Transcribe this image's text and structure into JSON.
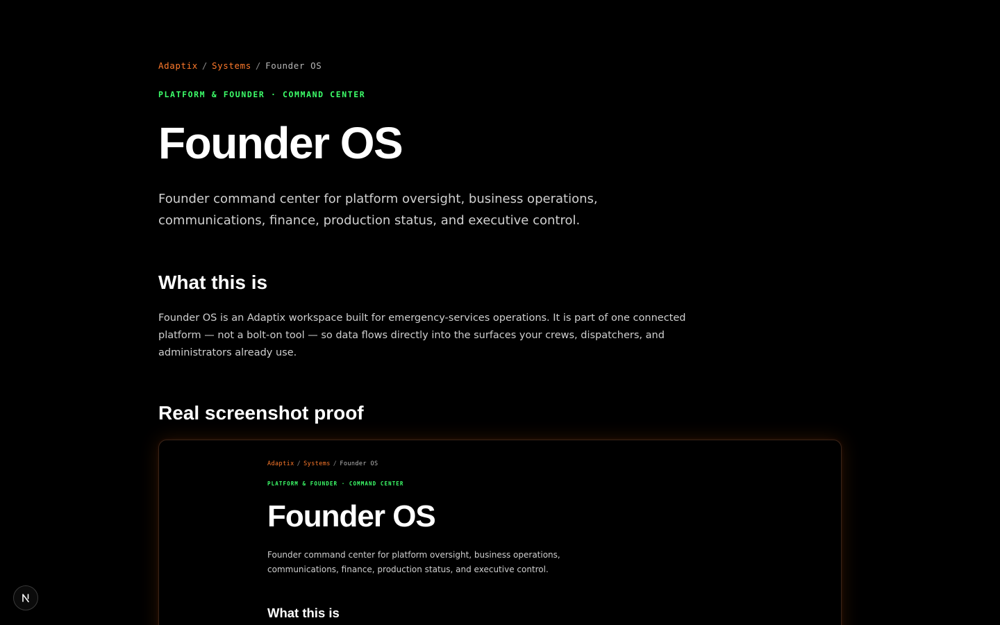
{
  "breadcrumb": {
    "items": [
      "Adaptix",
      "Systems"
    ],
    "separator": "/",
    "current": "Founder OS"
  },
  "eyebrow": "PLATFORM & FOUNDER · COMMAND CENTER",
  "title": "Founder OS",
  "lead": "Founder command center for platform oversight, business operations, communications, finance, production status, and executive control.",
  "sections": {
    "what": {
      "heading": "What this is",
      "body": "Founder OS is an Adaptix workspace built for emergency-services operations. It is part of one connected platform — not a bolt-on tool — so data flows directly into the surfaces your crews, dispatchers, and administrators already use."
    },
    "proof": {
      "heading": "Real screenshot proof"
    }
  },
  "screenshot": {
    "breadcrumb": {
      "items": [
        "Adaptix",
        "Systems"
      ],
      "separator": "/",
      "current": "Founder OS"
    },
    "eyebrow": "PLATFORM & FOUNDER · COMMAND CENTER",
    "title": "Founder OS",
    "lead": "Founder command center for platform oversight, business operations, communications, finance, production status, and executive control.",
    "heading": "What this is"
  },
  "dev_badge": {
    "icon": "nextjs-n-icon"
  },
  "colors": {
    "background": "#000000",
    "accent_link": "#ff7a2b",
    "eyebrow_green": "#3dff6a",
    "text_primary": "#ffffff",
    "text_secondary": "#d0d0d0",
    "frame_glow": "#ff6e14"
  }
}
